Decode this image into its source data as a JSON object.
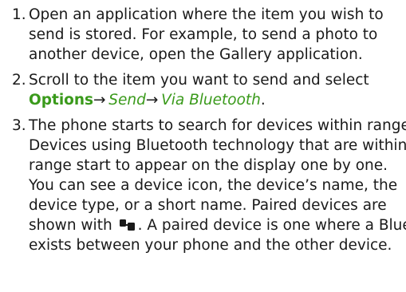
{
  "steps": [
    {
      "number": "1.",
      "lines": [
        "Open an application where the item you wish to",
        "send is stored. For example, to send a photo to",
        "another device, open the Gallery application."
      ]
    },
    {
      "number": "2.",
      "line1": "Scroll to the item you want to send and select",
      "options": "Options",
      "arrow": "→",
      "send": "Send",
      "via": "Via Bluetooth",
      "period": "."
    },
    {
      "number": "3.",
      "lines": [
        "The phone starts to search for devices within range.",
        "Devices using Bluetooth technology that are within",
        "range start to appear on the display one by one.",
        "You can see a device icon, the device’s name, the",
        "device type, or a short name. Paired devices are"
      ],
      "line6_before": "shown with",
      "paired_icon": "paired-device-icon",
      "line6_after": ". A paired device is one where a Blue",
      "line7": "exists between your phone and the other device."
    }
  ],
  "colors": {
    "accent_green": "#3a9a1b",
    "text": "#1a1a1a"
  }
}
